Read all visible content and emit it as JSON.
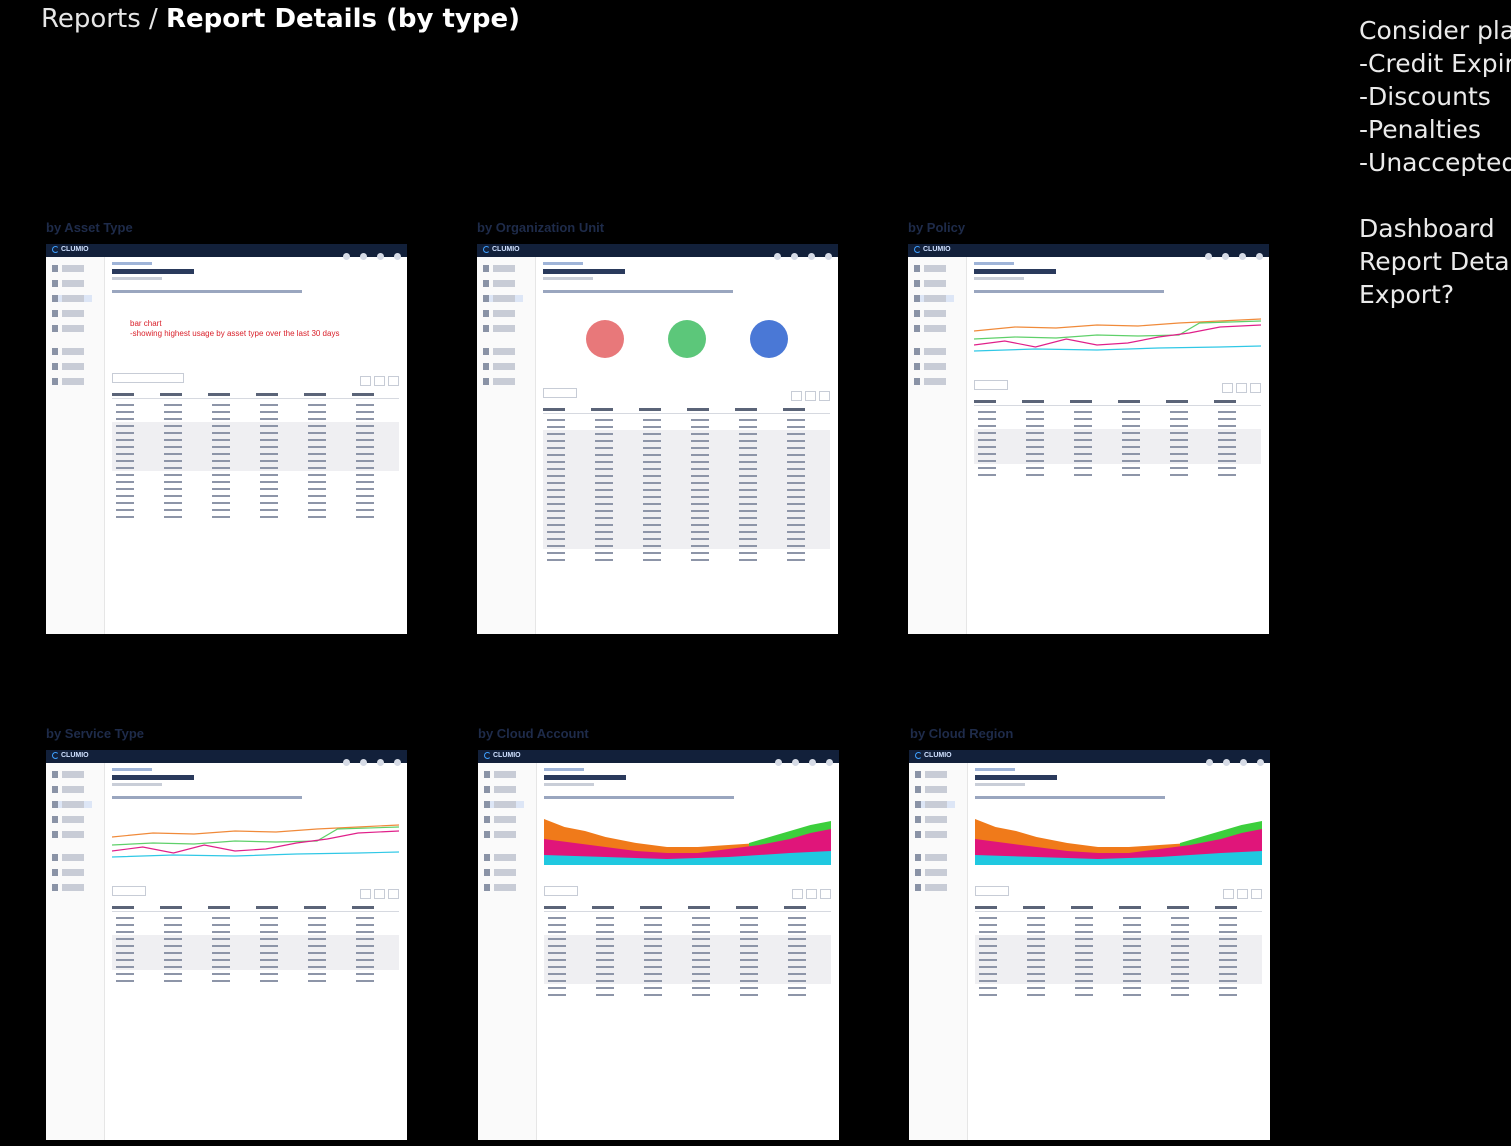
{
  "header": {
    "breadcrumb_parent": "Reports",
    "separator": " / ",
    "current": "Report Details (by type)"
  },
  "subtitle": "",
  "notes": {
    "lines": [
      "Consider pla",
      "-Credit Expir",
      "-Discounts",
      "-Penalties",
      "-Unaccepted",
      "",
      "Dashboard",
      "Report Detai",
      "Export?"
    ]
  },
  "panels": [
    {
      "label": "by Asset Type",
      "annotation": "bar chart\n-showing highest usage by asset type over the last 30 days"
    },
    {
      "label": "by Organization Unit"
    },
    {
      "label": "by Policy"
    },
    {
      "label": "by Service Type"
    },
    {
      "label": "by Cloud Account"
    },
    {
      "label": "by Cloud Region"
    }
  ],
  "app": {
    "logo": "CLUMIO"
  },
  "colors": {
    "background": "#000000",
    "app_topbar": "#12203a",
    "panel_label": "#1e2b4a",
    "annotation_red": "#d9202a",
    "pie_red": "#e8787a",
    "pie_green": "#5cc77a",
    "pie_blue": "#4a78d6",
    "area_orange": "#f07a1a",
    "area_magenta": "#e0157a",
    "area_green": "#3ccf3c",
    "area_cyan": "#20c8e0"
  }
}
